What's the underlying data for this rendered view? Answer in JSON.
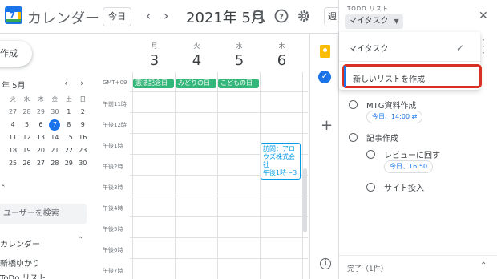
{
  "app": {
    "logo_number": "7",
    "title": "カレンダー"
  },
  "header": {
    "today_label": "今日",
    "prev": "‹",
    "next": "›",
    "month": "2021年 5月",
    "view_label": "週"
  },
  "sidebar": {
    "create_label": "作成",
    "mini_month": "年 5月",
    "mini_prev": "‹",
    "mini_next": "›",
    "mini_dow": [
      "火",
      "水",
      "木",
      "金",
      "土",
      "日"
    ],
    "mini_rows": [
      [
        "日",
        "月",
        "火",
        "水",
        "木",
        "金"
      ],
      [
        "27",
        "28",
        "29",
        "30",
        "1",
        "2"
      ],
      [
        "4",
        "5",
        "6",
        "7",
        "8",
        "9"
      ],
      [
        "11",
        "12",
        "13",
        "14",
        "15",
        "16"
      ],
      [
        "18",
        "19",
        "20",
        "21",
        "22",
        "23"
      ],
      [
        "25",
        "26",
        "27",
        "28",
        "29",
        "30"
      ]
    ],
    "search_placeholder": "ユーザーを検索",
    "my_calendars_label": "カレンダー",
    "calendar_items": [
      "新橋ゆかり",
      "ToDo リスト"
    ]
  },
  "grid": {
    "timezone": "GMT+09",
    "days": [
      {
        "dow": "月",
        "num": "3"
      },
      {
        "dow": "火",
        "num": "4"
      },
      {
        "dow": "水",
        "num": "5"
      },
      {
        "dow": "木",
        "num": "6"
      }
    ],
    "allday_events": [
      "憲法記念日",
      "みどりの日",
      "こどもの日"
    ],
    "times": [
      "午前11時",
      "午後12時",
      "午後1時",
      "午後2時",
      "午後3時",
      "午後4時",
      "午後5時",
      "午後6時",
      "午後7時"
    ],
    "event": {
      "title_lines": [
        "訪問：アロ",
        "ウズ株式会",
        "社"
      ],
      "time": "午後1時〜3"
    }
  },
  "tasks_panel": {
    "header_small": "TODO リスト",
    "list_name": "マイタスク",
    "menu": {
      "item_current": "マイタスク",
      "item_new_list": "新しいリストを作成"
    },
    "tasks": [
      {
        "title": "MTG資料作成",
        "chip": "今日、14:00 ⇄"
      },
      {
        "title": "記事作成",
        "chip": ""
      }
    ],
    "subtasks": [
      {
        "title": "レビューに回す",
        "chip": "今日、16:50"
      },
      {
        "title": "サイト投入",
        "chip": ""
      }
    ],
    "completed_label": "完了（1件）"
  },
  "colors": {
    "accent": "#1a73e8",
    "holiday": "#33b679",
    "highlight": "#d93025"
  }
}
